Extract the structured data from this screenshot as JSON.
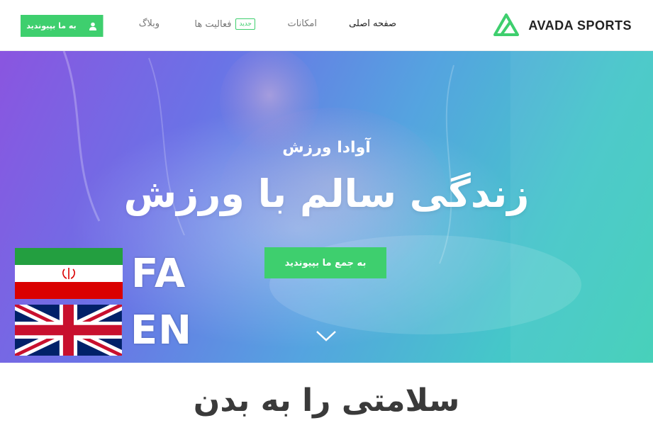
{
  "header": {
    "logo_text": "AVADA SPORTS",
    "nav": {
      "home": "صفحه اصلی",
      "features": "امکانات",
      "activities": "فعالیت ها",
      "activities_badge": "جدید",
      "blog": "وبلاگ"
    },
    "join_button": "به ما بپیوندید"
  },
  "hero": {
    "eyebrow": "آوادا ورزش",
    "title": "زندگی سالم با ورزش",
    "cta": "به جمع ما بپیوندید"
  },
  "languages": [
    {
      "code": "FA",
      "flag": "iran-flag"
    },
    {
      "code": "EN",
      "flag": "uk-flag"
    }
  ],
  "section": {
    "title": "سلامتی را به بدن"
  },
  "colors": {
    "accent": "#3ecf6e",
    "hero_gradient": [
      "#8a55e0",
      "#55a3e0",
      "#3fcfb7"
    ]
  }
}
